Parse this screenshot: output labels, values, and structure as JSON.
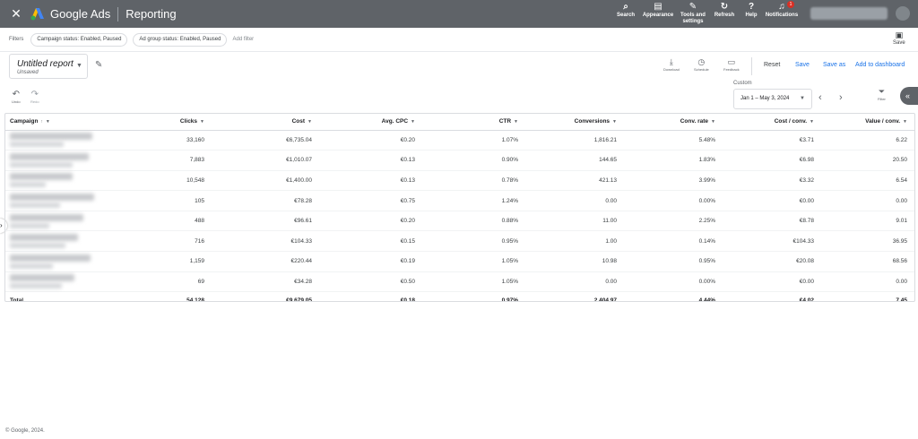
{
  "header": {
    "brand": "Google Ads",
    "section": "Reporting",
    "actions": [
      {
        "label": "Search",
        "icon": "search-icon"
      },
      {
        "label": "Appearance",
        "icon": "appearance-icon"
      },
      {
        "label": "Tools and settings",
        "icon": "wrench-icon"
      },
      {
        "label": "Refresh",
        "icon": "refresh-icon"
      },
      {
        "label": "Help",
        "icon": "help-icon"
      },
      {
        "label": "Notifications",
        "icon": "bell-icon"
      }
    ],
    "notification_count": "1",
    "colors": {
      "bar": "#5f6368",
      "accent": "#1a73e8"
    }
  },
  "filters": {
    "label": "Filters",
    "chips": [
      "Campaign status: Enabled, Paused",
      "Ad group status: Enabled, Paused"
    ],
    "add_label": "Add filter",
    "save_label": "Save"
  },
  "report": {
    "title": "Untitled report",
    "subtitle": "Unsaved",
    "download_label": "Download",
    "schedule_label": "Schedule",
    "feedback_label": "Feedback",
    "reset_label": "Reset",
    "save_label": "Save",
    "save_as_label": "Save as",
    "add_dashboard_label": "Add to dashboard"
  },
  "tools": {
    "undo_label": "Undo",
    "redo_label": "Redo",
    "date_mode": "Custom",
    "date_range": "Jan 1 – May 3, 2024",
    "filter_label": "Filter"
  },
  "table": {
    "columns": [
      "Campaign",
      "Clicks",
      "Cost",
      "Avg. CPC",
      "CTR",
      "Conversions",
      "Conv. rate",
      "Cost / conv.",
      "Value / conv."
    ],
    "rows": [
      [
        "33,160",
        "€6,735.04",
        "€0.20",
        "1.07%",
        "1,816.21",
        "5.48%",
        "€3.71",
        "6.22"
      ],
      [
        "7,883",
        "€1,010.07",
        "€0.13",
        "0.90%",
        "144.65",
        "1.83%",
        "€6.98",
        "20.50"
      ],
      [
        "10,548",
        "€1,400.00",
        "€0.13",
        "0.78%",
        "421.13",
        "3.99%",
        "€3.32",
        "6.54"
      ],
      [
        "105",
        "€78.28",
        "€0.75",
        "1.24%",
        "0.00",
        "0.00%",
        "€0.00",
        "0.00"
      ],
      [
        "488",
        "€96.61",
        "€0.20",
        "0.88%",
        "11.00",
        "2.25%",
        "€8.78",
        "9.01"
      ],
      [
        "716",
        "€104.33",
        "€0.15",
        "0.95%",
        "1.00",
        "0.14%",
        "€104.33",
        "36.95"
      ],
      [
        "1,159",
        "€220.44",
        "€0.19",
        "1.05%",
        "10.98",
        "0.95%",
        "€20.08",
        "68.56"
      ],
      [
        "69",
        "€34.28",
        "€0.50",
        "1.05%",
        "0.00",
        "0.00%",
        "€0.00",
        "0.00"
      ]
    ],
    "total": [
      "Total",
      "54,128",
      "€9,679.05",
      "€0.18",
      "0.97%",
      "2,404.97",
      "4.44%",
      "€4.02",
      "7.45"
    ]
  },
  "footer": {
    "text": "© Google, 2024."
  }
}
